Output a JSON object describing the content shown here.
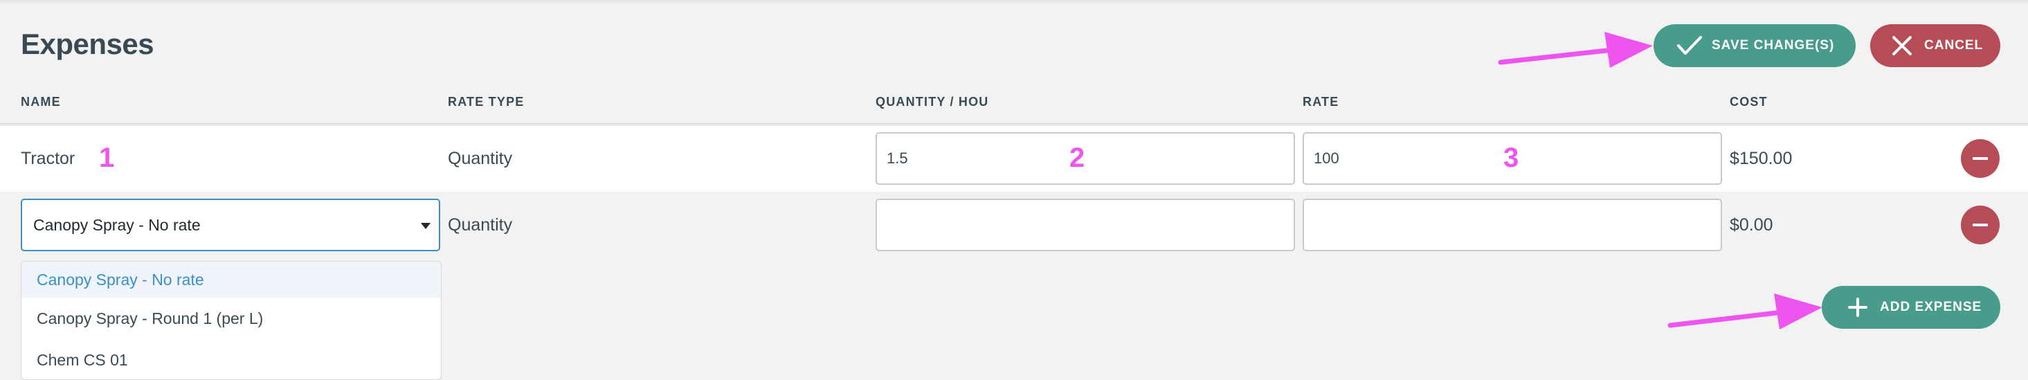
{
  "page": {
    "title": "Expenses"
  },
  "toolbar": {
    "save_label": "SAVE CHANGE(S)",
    "cancel_label": "CANCEL",
    "add_label": "ADD EXPENSE"
  },
  "table": {
    "headers": [
      "NAME",
      "RATE TYPE",
      "QUANTITY / HOU",
      "RATE",
      "COST"
    ],
    "rows": [
      {
        "name": "Tractor",
        "rate_type": "Quantity",
        "quantity": "1.5",
        "rate": "100",
        "cost": "$150.00"
      },
      {
        "name": "Canopy Spray - No rate",
        "rate_type": "Quantity",
        "quantity": "",
        "rate": "",
        "cost": "$0.00"
      }
    ]
  },
  "dropdown": {
    "options": [
      "Canopy Spray - No rate",
      "Canopy Spray - Round 1 (per L)",
      "Chem CS 01"
    ],
    "selected": "Canopy Spray - No rate"
  },
  "annotations": {
    "marker1": "1",
    "marker2": "2",
    "marker3": "3"
  },
  "colors": {
    "accent_green": "#479c8b",
    "danger_red": "#b64c55",
    "focus_blue": "#3b8fc6",
    "annotation_magenta": "#ee55ee"
  },
  "icons": {
    "save": "check-icon",
    "cancel": "close-icon",
    "add": "plus-icon",
    "remove": "minus-icon",
    "select": "caret-down-icon"
  }
}
